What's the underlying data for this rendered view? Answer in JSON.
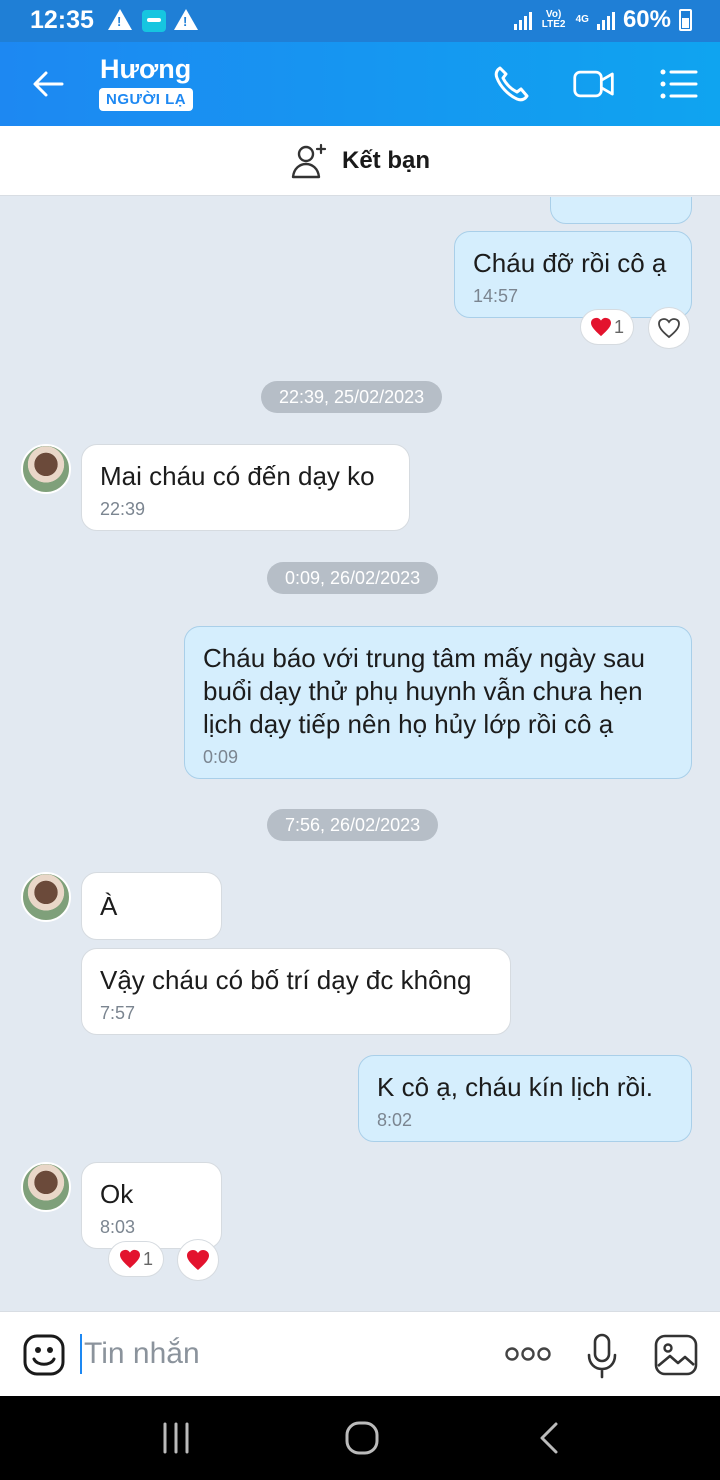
{
  "status_bar": {
    "time": "12:35",
    "network_label_top": "Vo) LTE2",
    "network_label_4g": "4G",
    "battery": "60%"
  },
  "header": {
    "contact_name": "Hương",
    "badge": "NGƯỜI LẠ"
  },
  "add_friend": {
    "label": "Kết bạn"
  },
  "messages": {
    "m1": {
      "text": "Cháu đỡ rồi cô ạ",
      "time": "14:57",
      "reaction_count": "1"
    },
    "d1": "22:39, 25/02/2023",
    "m2": {
      "text": "Mai cháu có đến dạy ko",
      "time": "22:39"
    },
    "d2": "0:09, 26/02/2023",
    "m3": {
      "text": "Cháu báo với trung tâm mấy ngày sau buổi dạy thử phụ huynh vẫn chưa hẹn lịch dạy tiếp nên họ hủy lớp rồi cô ạ",
      "time": "0:09"
    },
    "d3": "7:56, 26/02/2023",
    "m4": {
      "text": "À"
    },
    "m5": {
      "text": "Vậy cháu có bố trí dạy đc không",
      "time": "7:57"
    },
    "m6": {
      "text": "K cô ạ, cháu kín lịch rồi.",
      "time": "8:02"
    },
    "m7": {
      "text": "Ok",
      "time": "8:03",
      "reaction_count": "1"
    }
  },
  "input": {
    "placeholder": "Tin nhắn"
  },
  "colors": {
    "header": "#1d88f2",
    "outgoing_bubble": "#d5eefd",
    "background": "#e2e9f1"
  }
}
